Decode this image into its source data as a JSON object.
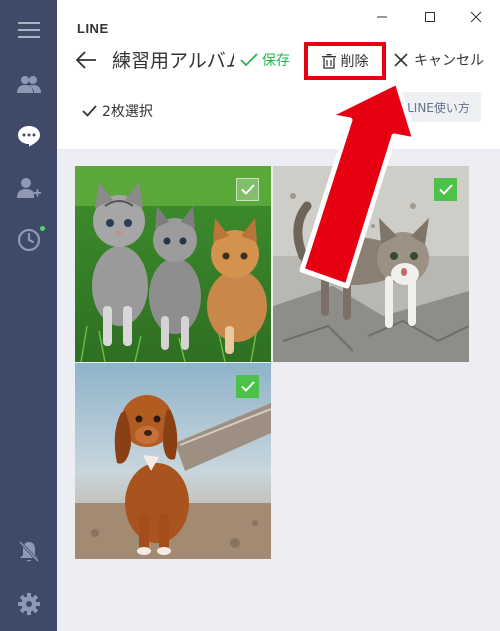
{
  "app": {
    "title": "LINE"
  },
  "header": {
    "album_title": "練習用アルバム",
    "save_label": "保存",
    "delete_label": "削除",
    "cancel_label": "キャンセル"
  },
  "toolbar": {
    "selection_count": "2枚選択",
    "help_label": "LINE使い方"
  },
  "sidebar": {
    "items": [
      {
        "icon": "menu-icon"
      },
      {
        "icon": "friends-icon"
      },
      {
        "icon": "chat-bubble-icon"
      },
      {
        "icon": "add-friend-icon"
      },
      {
        "icon": "timeline-clock-icon"
      },
      {
        "icon": "notification-off-icon"
      },
      {
        "icon": "gear-icon"
      }
    ]
  },
  "photos": [
    {
      "subject": "kittens",
      "checked": true
    },
    {
      "subject": "kitten",
      "checked": true
    },
    {
      "subject": "puppy",
      "checked": true
    }
  ],
  "colors": {
    "sidebar": "#3e4a68",
    "accent_green": "#22b94a",
    "check_green": "#4cc24a",
    "highlight_red": "#e60012",
    "grid_bg": "#eceef3"
  }
}
